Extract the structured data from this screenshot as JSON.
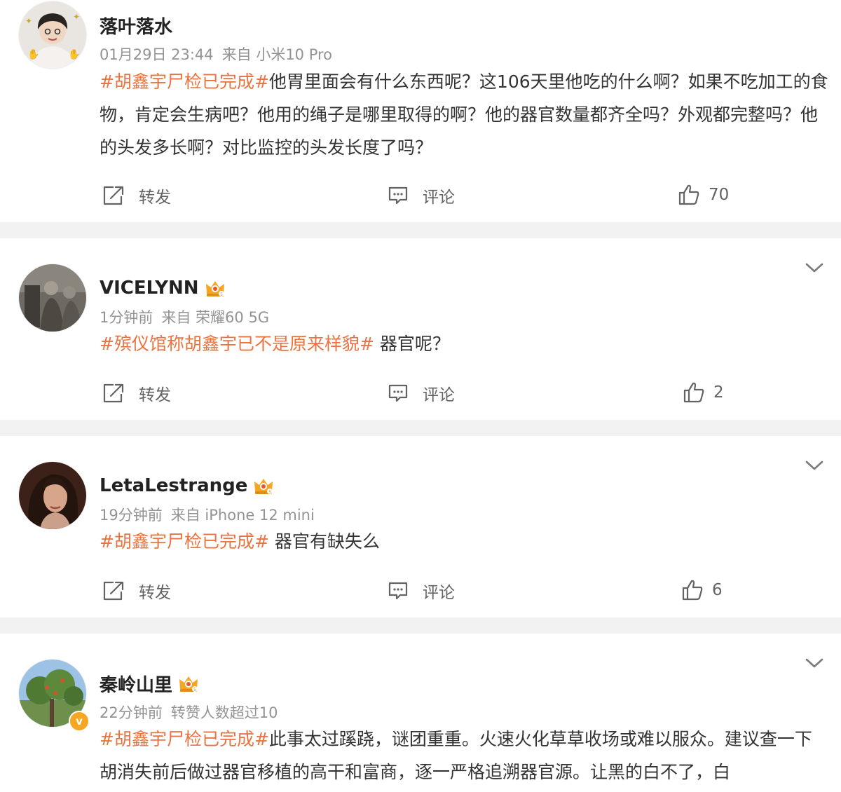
{
  "posts": [
    {
      "username": "落叶落水",
      "time": "01月29日 23:44",
      "source": "来自 小米10 Pro",
      "tag": "#胡鑫宇尸检已完成#",
      "body": "他胃里面会有什么东西呢？这106天里他吃的什么啊？如果不吃加工的食物，肯定会生病吧？他用的绳子是哪里取得的啊？他的器官数量都齐全吗？外观都完整吗？他的头发多长啊？对比监控的头发长度了吗？",
      "repost_label": "转发",
      "comment_label": "评论",
      "like_count": "70"
    },
    {
      "username": "VICELYNN",
      "time": "1分钟前",
      "source": "来自 荣耀60 5G",
      "tag": "#殡仪馆称胡鑫宇已不是原来样貌#",
      "body": " 器官呢？",
      "repost_label": "转发",
      "comment_label": "评论",
      "like_count": "2"
    },
    {
      "username": "LetaLestrange",
      "time": "19分钟前",
      "source": "来自 iPhone 12 mini",
      "tag": "#胡鑫宇尸检已完成#",
      "body": " 器官有缺失么",
      "repost_label": "转发",
      "comment_label": "评论",
      "like_count": "6"
    },
    {
      "username": "秦岭山里",
      "time": "22分钟前",
      "source": "转赞人数超过10",
      "tag": "#胡鑫宇尸检已完成#",
      "body": "此事太过蹊跷，谜团重重。火速火化草草收场或难以服众。建议查一下胡消失前后做过器官移植的高干和富商，逐一严格追溯器官源。让黑的白不了，白",
      "verified_badge": "v"
    }
  ],
  "colors": {
    "tag": "#eb7340",
    "username": "#222222",
    "meta": "#939393",
    "body": "#333333",
    "action": "#636363",
    "crown": "#f5a623",
    "separator": "#f2f2f2"
  },
  "icons": {
    "repost": "share-square-icon",
    "comment": "comment-bubble-icon",
    "like": "thumbs-up-icon",
    "more": "chevron-down-icon",
    "member": "crown-badge-icon"
  }
}
